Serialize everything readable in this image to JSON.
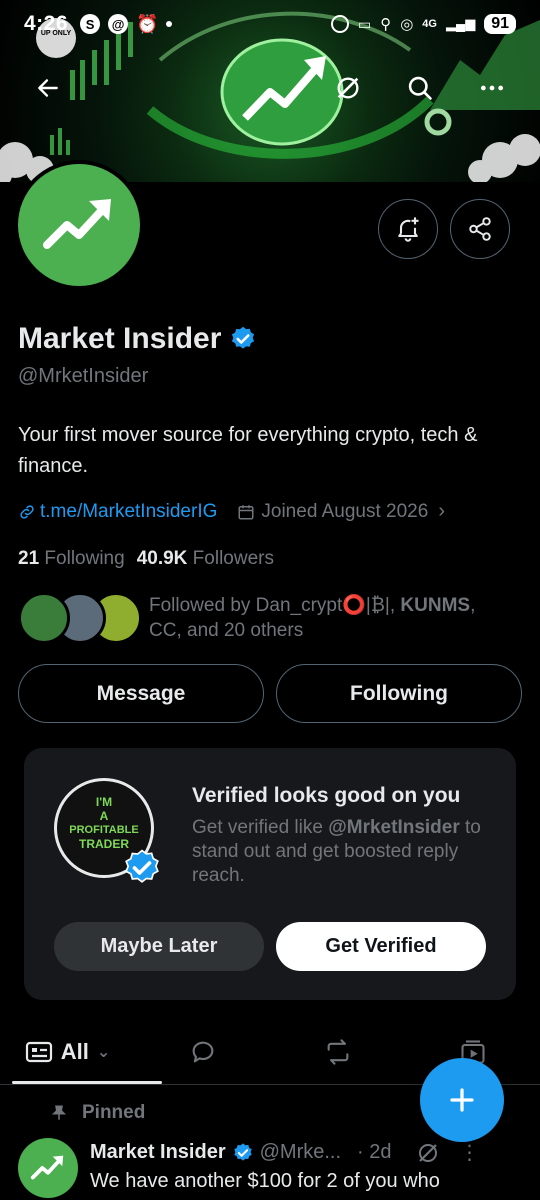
{
  "status_bar": {
    "time": "4:26",
    "network": "4G",
    "battery": "91"
  },
  "banner": {
    "logo_text": "UP ONLY"
  },
  "profile": {
    "name": "Market Insider",
    "handle": "@MrketInsider",
    "bio": "Your first mover source for everything crypto, tech & finance.",
    "link": "t.me/MarketInsiderIG",
    "joined": "Joined August 2026",
    "following_count": "21",
    "following_label": "Following",
    "followers_count": "40.9K",
    "followers_label": "Followers",
    "followed_by_prefix": "Followed by Dan_crypt⭕|₿|, ",
    "followed_by_bold": "KUNMS",
    "followed_by_suffix": ", CC, and 20 others"
  },
  "actions": {
    "message": "Message",
    "following": "Following"
  },
  "verified_card": {
    "title": "Verified looks good on you",
    "body_prefix": "Get verified like ",
    "body_handle": "@MrketInsider",
    "body_suffix": " to stand out and get boosted reply reach.",
    "image_text_1": "I'M",
    "image_text_2": "A",
    "image_text_3": "PROFITABLE",
    "image_text_4": "TRADER",
    "maybe_later": "Maybe Later",
    "get_verified": "Get Verified"
  },
  "tabs": {
    "all_label": "All"
  },
  "pinned": {
    "label": "Pinned",
    "name": "Market Insider",
    "handle": "@Mrke...",
    "time": "· 2d",
    "text": "We have another $100 for 2 of you who"
  },
  "colors": {
    "accent": "#1d9bf0",
    "brand_green": "#4caf50",
    "background": "#000000",
    "card": "#16181c",
    "muted": "#71767b"
  }
}
